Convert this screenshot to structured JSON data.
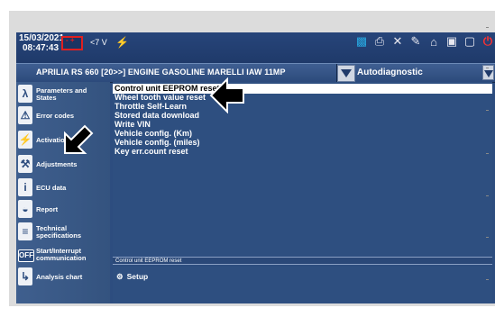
{
  "topbar": {
    "date": "15/03/2021",
    "time": "08:47:43",
    "battery_label": "- +",
    "voltage": "<7 V",
    "usb_glyph": "⚡",
    "icons": [
      "database-icon",
      "printer-icon",
      "tools-icon",
      "pen-icon",
      "home-icon",
      "camera-icon",
      "window-icon",
      "power-icon"
    ]
  },
  "header": {
    "vehicle": "APRILIA RS  660  [20>>] ENGINE GASOLINE MARELLI IAW 11MP",
    "section": "Autodiagnostic"
  },
  "sidebar": {
    "items": [
      {
        "label": "Parameters and States",
        "icon": "lambda-icon",
        "glyph": "λ"
      },
      {
        "label": "Error codes",
        "icon": "warning-icon",
        "glyph": "⚠"
      },
      {
        "label": "Activations",
        "icon": "lightning-icon",
        "glyph": "⚡"
      },
      {
        "label": "Adjustments",
        "icon": "wrench-icon",
        "glyph": "⚒"
      },
      {
        "label": "ECU data",
        "icon": "info-icon",
        "glyph": "i"
      },
      {
        "label": "Report",
        "icon": "report-icon",
        "glyph": "◒"
      },
      {
        "label": "Technical specifications",
        "icon": "document-icon",
        "glyph": "≡"
      },
      {
        "label": "Start/Interrupt communication",
        "icon": "off-icon",
        "glyph": "OFF"
      },
      {
        "label": "Analysis chart",
        "icon": "chart-icon",
        "glyph": "↳"
      }
    ]
  },
  "main": {
    "items": [
      "Control unit EEPROM reset",
      "Wheel tooth value reset",
      "Throttle Self-Learn",
      "Stored data download",
      "Write VIN",
      "Vehicle config. (Km)",
      "Vehicle config. (miles)",
      "Key err.count reset"
    ],
    "selected_index": 0,
    "status_text": "Control unit EEPROM reset",
    "setup_label": "Setup",
    "setup_glyph": "⚙"
  },
  "colors": {
    "screen_bg": "#2d4d7f",
    "sidebar_bg": "#3f5f8e",
    "selected_bg": "#ffffff",
    "power": "#ff3030",
    "battery": "#e02020"
  }
}
